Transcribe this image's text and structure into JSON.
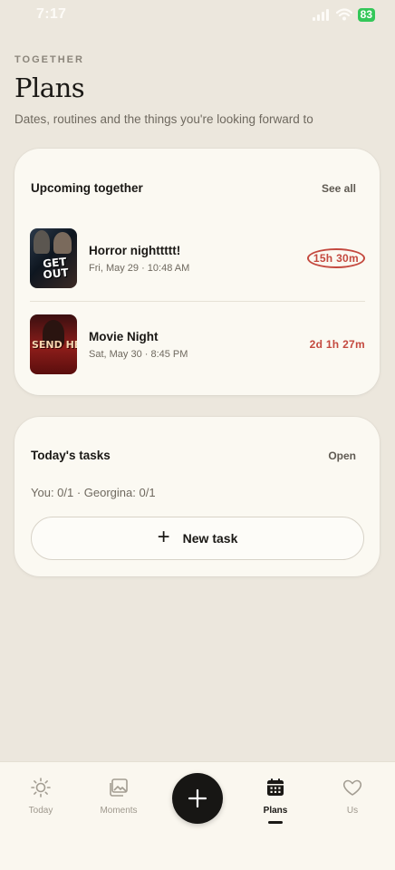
{
  "status_bar": {
    "time": "7:17",
    "battery": "83"
  },
  "header": {
    "eyebrow": "TOGETHER",
    "title": "Plans",
    "subtitle": "Dates, routines and the things you're looking forward to"
  },
  "upcoming": {
    "title": "Upcoming together",
    "see_all": "See all",
    "items": [
      {
        "name": "Horror nighttttt!",
        "date": "Fri, May 29 · 10:48 AM",
        "countdown": "15h 30m",
        "poster_text": "GET OUT"
      },
      {
        "name": "Movie Night",
        "date": "Sat, May 30 · 8:45 PM",
        "countdown": "2d 1h 27m",
        "poster_text": "SEND HELP"
      }
    ]
  },
  "tasks": {
    "title": "Today's tasks",
    "open": "Open",
    "progress": "You: 0/1 · Georgina: 0/1",
    "new_task": "New task"
  },
  "tabs": [
    {
      "label": "Today",
      "icon": "sun-icon",
      "active": false
    },
    {
      "label": "Moments",
      "icon": "image-icon",
      "active": false
    },
    {
      "label": "Plans",
      "icon": "calendar-icon",
      "active": true
    },
    {
      "label": "Us",
      "icon": "heart-icon",
      "active": false
    }
  ],
  "colors": {
    "background": "#ece7dd",
    "card": "#fbf9f2",
    "countdown": "#c4493f",
    "fab": "#171614"
  }
}
